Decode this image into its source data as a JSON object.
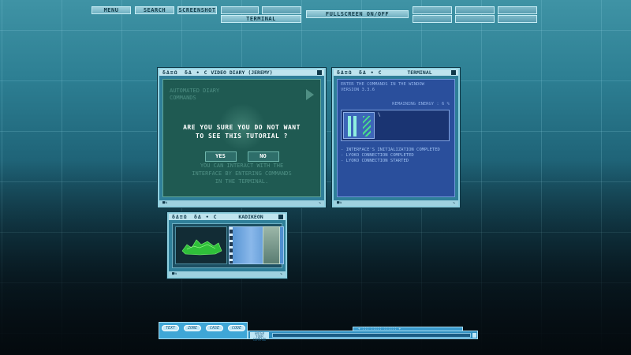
{
  "top_menu": {
    "menu": "MENU",
    "search": "SEARCH",
    "screenshot": "SCREENSHOT",
    "terminal": "TERMINAL",
    "fullscreen": "FULLSCREEN ON/OFF"
  },
  "video_diary": {
    "title": "VIDEO DIARY (JEREMY)",
    "header_line1": "AUTOMATED DIARY",
    "header_line2": "COMMANDS",
    "question_line1": "ARE YOU SURE YOU DO NOT WANT",
    "question_line2": "TO SEE THIS TUTORIAL ?",
    "yes": "YES",
    "no": "NO",
    "footer_line1": "YOU CAN INTERACT WITH THE",
    "footer_line2": "INTERFACE BY ENTERING COMMANDS",
    "footer_line3": "IN THE TERMINAL."
  },
  "terminal": {
    "title": "TERMINAL",
    "hint_line1": "ENTER THE COMMANDS IN THE WINDOW",
    "hint_line2": "VERSION 3.3.6",
    "energy": "REMAINING ENERGY : 6 %",
    "input_value": "\\",
    "log": [
      "- INTERFACE'S INITIALIZATION COMPLETED",
      "- LYOKO CONNECTION COMPLETED",
      "- LYOKO CONNECTION STARTED"
    ]
  },
  "kadikeon": {
    "title": "KADIKEON"
  },
  "taskbar": {
    "buttons": [
      "TEXT",
      "ZONE",
      "CASE",
      "CODE"
    ],
    "cmd_label": "ENTER YOUR COMMAND",
    "cmd_tab": "+ ::: ::::: :::::: +"
  },
  "window_glyphs": "δΔ≡Ω",
  "window_glyphs2": "δΔ • С"
}
